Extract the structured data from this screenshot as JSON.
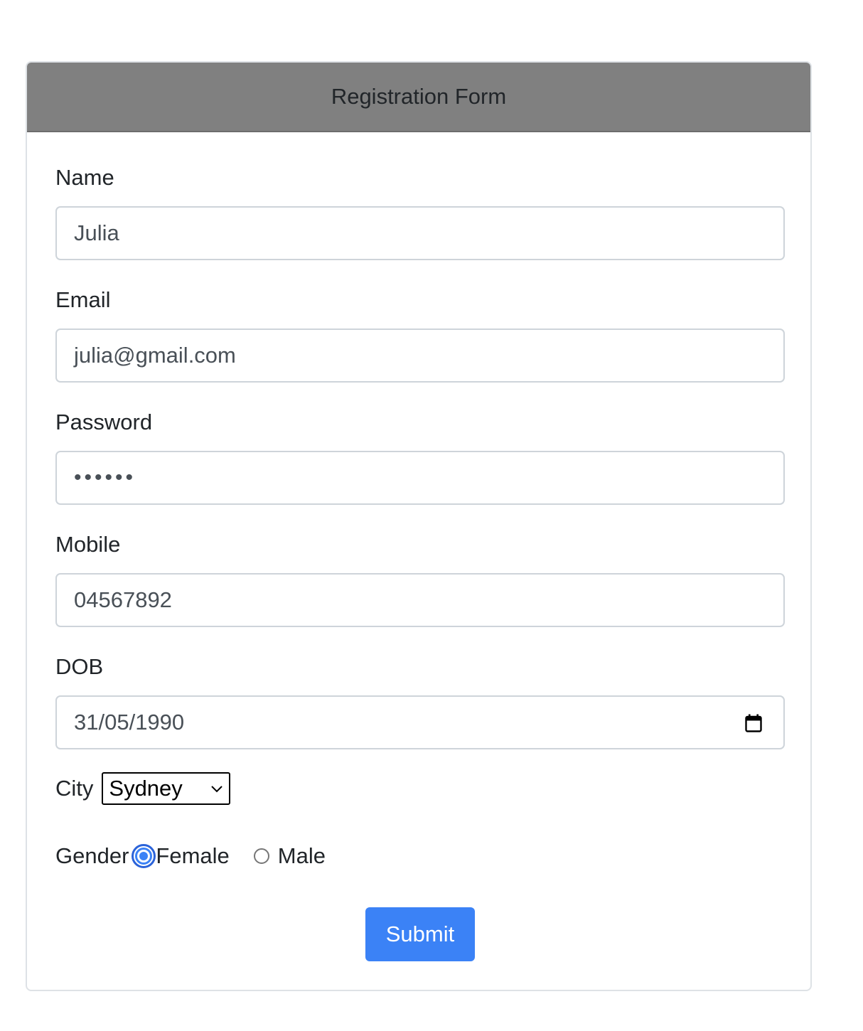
{
  "form": {
    "title": "Registration Form",
    "name": {
      "label": "Name",
      "value": "Julia"
    },
    "email": {
      "label": "Email",
      "value": "julia@gmail.com"
    },
    "password": {
      "label": "Password",
      "masked_value": "••••••"
    },
    "mobile": {
      "label": "Mobile",
      "value": "04567892"
    },
    "dob": {
      "label": "DOB",
      "value": "31/05/1990"
    },
    "city": {
      "label": "City",
      "selected": "Sydney"
    },
    "gender": {
      "label": "Gender",
      "options": [
        {
          "label": "Female",
          "checked": true
        },
        {
          "label": "Male",
          "checked": false
        }
      ]
    },
    "submit_label": "Submit"
  },
  "colors": {
    "header_bg": "#808080",
    "primary": "#3b82f6"
  }
}
